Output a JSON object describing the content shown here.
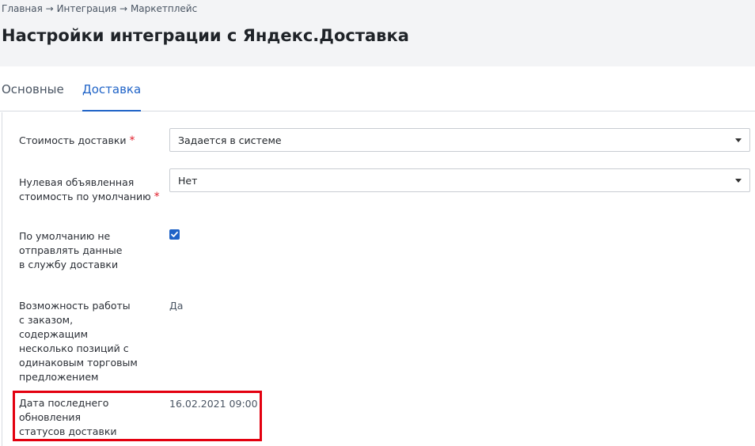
{
  "breadcrumb": {
    "items": [
      "Главная",
      "Интеграция",
      "Маркетплейс"
    ],
    "separator": "→"
  },
  "page": {
    "title": "Настройки интеграции с Яндекс.Доставка"
  },
  "tabs": [
    {
      "label": "Основные",
      "active": false
    },
    {
      "label": "Доставка",
      "active": true
    }
  ],
  "form": {
    "delivery_cost": {
      "label": "Стоимость доставки",
      "required": "*",
      "value": "Задается в системе"
    },
    "zero_declared_value": {
      "label_line1": "Нулевая объявленная",
      "label_line2": "стоимость по умолчанию",
      "required": "*",
      "value": "Нет"
    },
    "no_send_default": {
      "label": "По умолчанию не отправлять данные в службу доставки",
      "checked": true
    },
    "multi_position": {
      "label": "Возможность работы с заказом, содержащим несколько позиций с одинаковым торговым предложением",
      "value": "Да"
    },
    "last_status_update": {
      "label": "Дата последнего обновления статусов доставки",
      "value": "16.02.2021 09:00"
    }
  },
  "colors": {
    "accent": "#1f63c7",
    "required": "#e11d2a",
    "highlight": "#e3000f",
    "header_bg": "#f3f4f6"
  },
  "icons": {
    "select_caret": "caret-down-icon",
    "checkbox": "checkmark-icon"
  }
}
